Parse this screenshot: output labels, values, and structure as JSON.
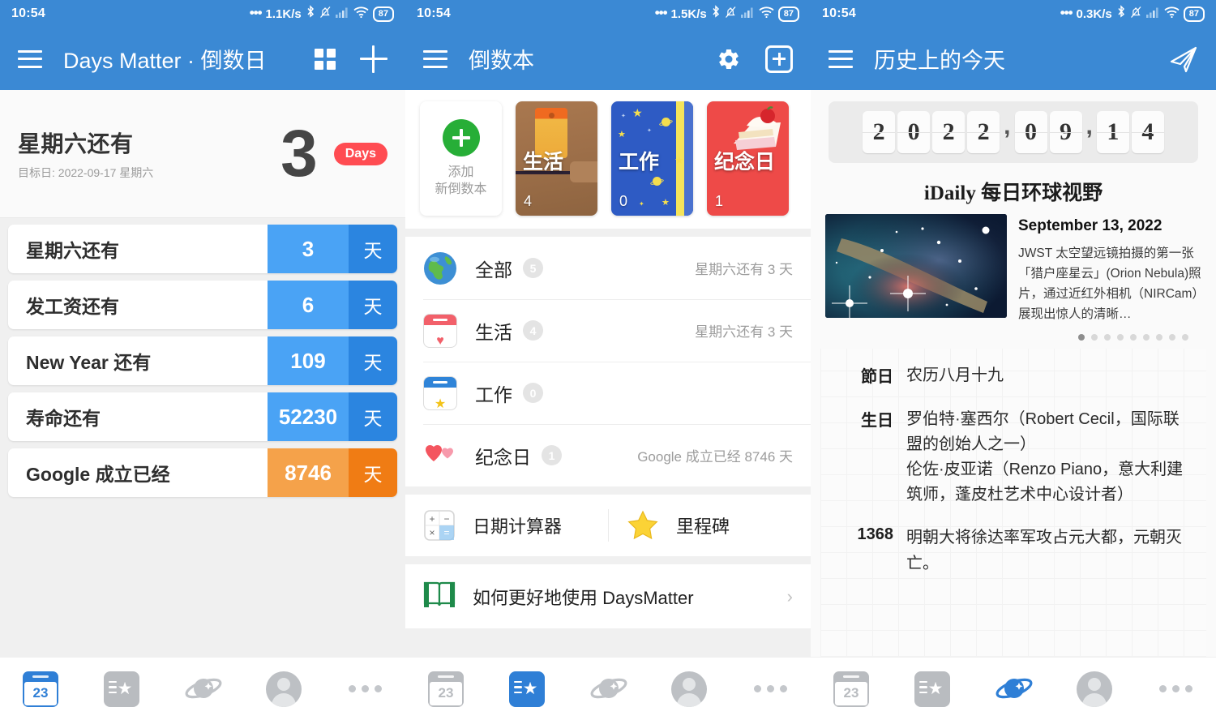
{
  "panels": [
    {
      "status": {
        "time": "10:54",
        "speed": "1.1K/s",
        "battery": "87"
      },
      "appbar": {
        "title": "Days Matter · 倒数日"
      },
      "hero": {
        "title": "星期六还有",
        "subtitle": "目标日: 2022-09-17 星期六",
        "number": "3",
        "badge": "Days"
      },
      "countdowns": [
        {
          "name": "星期六还有",
          "value": "3",
          "unit": "天",
          "color": "blue"
        },
        {
          "name": "发工资还有",
          "value": "6",
          "unit": "天",
          "color": "blue"
        },
        {
          "name": "New Year 还有",
          "value": "109",
          "unit": "天",
          "color": "blue"
        },
        {
          "name": "寿命还有",
          "value": "52230",
          "unit": "天",
          "color": "blue"
        },
        {
          "name": "Google 成立已经",
          "value": "8746",
          "unit": "天",
          "color": "orange"
        }
      ]
    },
    {
      "status": {
        "time": "10:54",
        "speed": "1.5K/s",
        "battery": "87"
      },
      "appbar": {
        "title": "倒数本"
      },
      "books": [
        {
          "label": "",
          "count": "",
          "add_line1": "添加",
          "add_line2": "新倒数本",
          "kind": "add"
        },
        {
          "label": "生活",
          "count": "4",
          "kind": "life"
        },
        {
          "label": "工作",
          "count": "0",
          "kind": "work"
        },
        {
          "label": "纪念日",
          "count": "1",
          "kind": "anniversary"
        }
      ],
      "categories": [
        {
          "icon": "globe-icon",
          "name": "全部",
          "count": "5",
          "detail": "星期六还有 3 天"
        },
        {
          "icon": "calendar-heart-icon",
          "name": "生活",
          "count": "4",
          "detail": "星期六还有 3 天"
        },
        {
          "icon": "calendar-star-icon",
          "name": "工作",
          "count": "0",
          "detail": ""
        },
        {
          "icon": "hearts-icon",
          "name": "纪念日",
          "count": "1",
          "detail": "Google 成立已经 8746 天"
        }
      ],
      "tools": [
        {
          "icon": "calculator-icon",
          "label": "日期计算器"
        },
        {
          "icon": "star-icon",
          "label": "里程碑"
        }
      ],
      "howto": {
        "icon": "book-icon",
        "label": "如何更好地使用 DaysMatter"
      }
    },
    {
      "status": {
        "time": "10:54",
        "speed": "0.3K/s",
        "battery": "87"
      },
      "appbar": {
        "title": "历史上的今天"
      },
      "flipdate": {
        "digits": [
          "2",
          "0",
          "2",
          "2",
          ",",
          "0",
          "9",
          ",",
          "1",
          "4"
        ]
      },
      "idaily": {
        "brand": "iDaily 每日环球视野",
        "date": "September 13, 2022",
        "description": "JWST 太空望远镜拍摄的第一张「猎户座星云」(Orion Nebula)照片，通过近红外相机（NIRCam）展现出惊人的清晰…",
        "dots_total": 9,
        "dots_active": 1
      },
      "history": [
        {
          "label": "節日",
          "lines": [
            "农历八月十九"
          ]
        },
        {
          "label": "生日",
          "lines": [
            "罗伯特·塞西尔（Robert Cecil，国际联盟的创始人之一）",
            "伦佐·皮亚诺（Renzo Piano，意大利建筑师，蓬皮杜艺术中心设计者）"
          ]
        },
        {
          "label": "1368",
          "lines": [
            "明朝大将徐达率军攻占元大都，元朝灭亡。"
          ]
        }
      ]
    }
  ],
  "bottom_nav": [
    {
      "items": [
        "calendar-23-icon",
        "notebook-star-icon",
        "planet-icon",
        "avatar-icon",
        "more-icon"
      ],
      "active": 0
    },
    {
      "items": [
        "calendar-23-icon",
        "notebook-star-icon",
        "planet-icon",
        "avatar-icon",
        "more-icon"
      ],
      "active": 1
    },
    {
      "items": [
        "calendar-23-icon",
        "notebook-star-icon",
        "planet-icon",
        "avatar-icon",
        "more-icon"
      ],
      "active": 2
    }
  ],
  "colors": {
    "accent": "#3b89d4",
    "badge_red": "#ff4c52",
    "bar_blue_light": "#4aa3f5",
    "bar_blue_dark": "#2b85e0",
    "bar_orange_light": "#f5a24a",
    "bar_orange_dark": "#f07c14",
    "nav_active": "#2f7fd6",
    "nav_inactive": "#b9bcc0"
  },
  "nav_calendar_day": "23"
}
